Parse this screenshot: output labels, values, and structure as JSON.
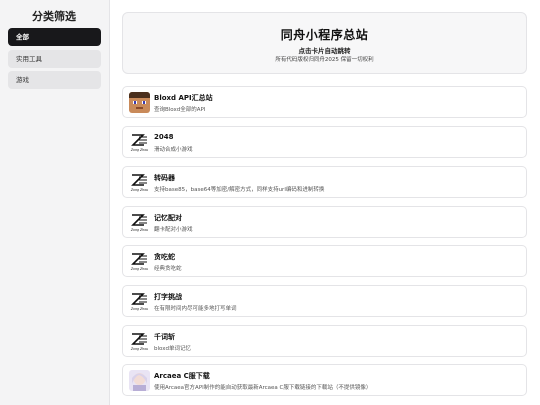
{
  "sidebar": {
    "title": "分类筛选",
    "items": [
      {
        "label": "全部",
        "active": true
      },
      {
        "label": "实用工具",
        "active": false
      },
      {
        "label": "游戏",
        "active": false
      }
    ]
  },
  "header": {
    "title": "同舟小程序总站",
    "subtitle": "点击卡片自动跳转",
    "note": "所有代码版权归同舟2025 保留一切权利"
  },
  "cards": [
    {
      "title": "Bloxd API汇总站",
      "desc": "查询Bloxd全部的API",
      "icon": "bloxd-avatar-icon"
    },
    {
      "title": "2048",
      "desc": "滑动合成小游戏",
      "icon": "zong-zhou-logo-icon"
    },
    {
      "title": "转码器",
      "desc": "支持base85，base64等加密/解密方式，同样支持url编码和进制转换",
      "icon": "zong-zhou-logo-icon"
    },
    {
      "title": "记忆配对",
      "desc": "翻卡配对小游戏",
      "icon": "zong-zhou-logo-icon"
    },
    {
      "title": "贪吃蛇",
      "desc": "经典贪吃蛇",
      "icon": "zong-zhou-logo-icon"
    },
    {
      "title": "打字挑战",
      "desc": "在有限时间内尽可能多地打写单词",
      "icon": "zong-zhou-logo-icon"
    },
    {
      "title": "千词斩",
      "desc": "bloxd单词记忆",
      "icon": "zong-zhou-logo-icon"
    },
    {
      "title": "Arcaea C服下载",
      "desc": "使用Arcaea官方API制作的能自动获取最新Arcaea C服下载链接的下载站（不提供镜像）",
      "icon": "arcaea-character-icon"
    }
  ],
  "logo_text": {
    "line1": "Z",
    "line2": "Zong Zhou"
  },
  "colors": {
    "active_bg": "#18181b",
    "sidebar_bg": "#f4f4f5",
    "border": "#e4e4e7"
  }
}
